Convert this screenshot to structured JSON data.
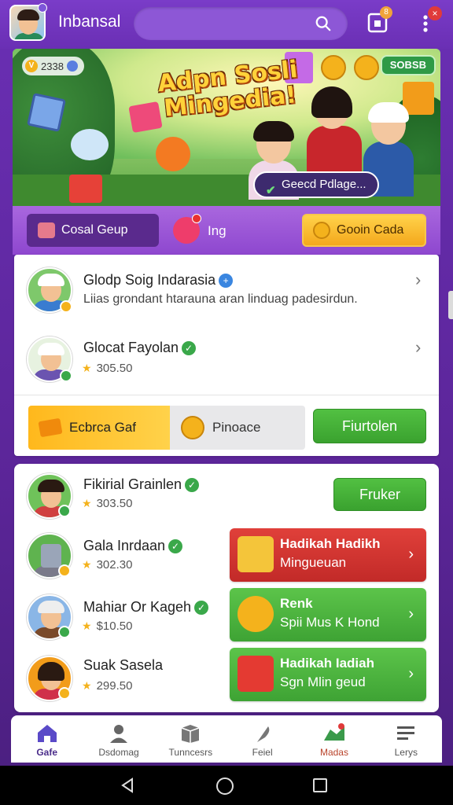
{
  "header": {
    "title": "Inbansal",
    "close_badge": "×",
    "gift_badge": "8"
  },
  "banner": {
    "headline_line1": "Adpn Sosli",
    "headline_line2": "Mingedia!",
    "coin_count": "2338",
    "coin_symbol": "V",
    "right_pill": "SOBSB",
    "cta": "Geecd Pdlage..."
  },
  "tabs": {
    "social": "Cosal Geup",
    "heart_label": "Ing",
    "coin_cta": "Gooin Cada"
  },
  "card1": {
    "row1": {
      "name": "Glodp Soig Indarasia",
      "desc": "Liias grondant htarauna aran linduag padesirdun."
    },
    "row2": {
      "name": "Glocat Fayolan",
      "score": "305.50"
    },
    "buttons": {
      "exchange": "Ecbrca Gaf",
      "pinoace": "Pinoace",
      "fiurtolen": "Fiurtolen"
    }
  },
  "card2": {
    "rows": [
      {
        "name": "Fikirial Grainlen",
        "score": "303.50"
      },
      {
        "name": "Gala Inrdaan",
        "score": "302.30"
      },
      {
        "name": "Mahiar Or Kageh",
        "score": "$10.50"
      },
      {
        "name": "Suak Sasela",
        "score": "299.50"
      }
    ],
    "fruker": "Fruker",
    "promos": [
      {
        "title": "Hadikah Hadikh",
        "subtitle": "Mingueuan",
        "color": "#d1312e"
      },
      {
        "title": "Renk",
        "subtitle": "Spii Mus K Hond",
        "color": "#4cb23f"
      },
      {
        "title": "Hadikah Iadiah",
        "subtitle": "Sgn Mlin geud",
        "color": "#4cb23f"
      }
    ]
  },
  "bottom_nav": [
    {
      "label": "Gafe",
      "icon": "home-icon"
    },
    {
      "label": "Dsdomag",
      "icon": "profile-icon"
    },
    {
      "label": "Tunncesrs",
      "icon": "box-icon"
    },
    {
      "label": "Feiel",
      "icon": "feather-icon"
    },
    {
      "label": "Madas",
      "icon": "map-pin-icon"
    },
    {
      "label": "Lerys",
      "icon": "list-icon"
    }
  ],
  "colors": {
    "primary_purple": "#6a2fb4",
    "accent_gold": "#f4b21c",
    "green": "#4cb23f",
    "red": "#d1312e"
  }
}
